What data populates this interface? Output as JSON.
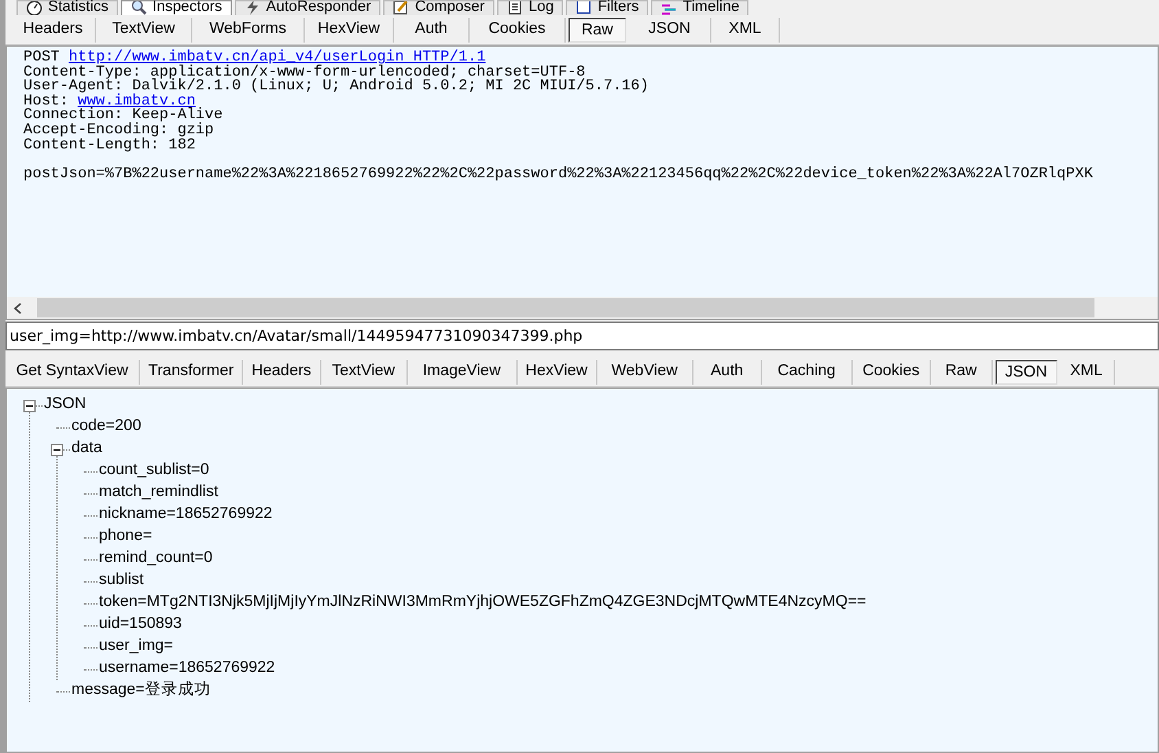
{
  "main_tabs": [
    {
      "label": "Statistics",
      "selected": false
    },
    {
      "label": "Inspectors",
      "selected": true
    },
    {
      "label": "AutoResponder",
      "selected": false
    },
    {
      "label": "Composer",
      "selected": false
    },
    {
      "label": "Log",
      "selected": false
    },
    {
      "label": "Filters",
      "selected": false
    },
    {
      "label": "Timeline",
      "selected": false
    }
  ],
  "request_tabs": [
    {
      "label": "Headers",
      "selected": false
    },
    {
      "label": "TextView",
      "selected": false
    },
    {
      "label": "WebForms",
      "selected": false
    },
    {
      "label": "HexView",
      "selected": false
    },
    {
      "label": "Auth",
      "selected": false
    },
    {
      "label": "Cookies",
      "selected": false
    },
    {
      "label": "Raw",
      "selected": true
    },
    {
      "label": "JSON",
      "selected": false
    },
    {
      "label": "XML",
      "selected": false
    }
  ],
  "raw_request": {
    "headers": [
      [
        {
          "kind": "text",
          "text": "POST "
        },
        {
          "kind": "link",
          "text": "http://www.imbatv.cn/api_v4/userLogin HTTP/1.1"
        }
      ],
      [
        {
          "kind": "text",
          "text": "Content-Type: application/x-www-form-urlencoded; charset=UTF-8"
        }
      ],
      [
        {
          "kind": "text",
          "text": "User-Agent: Dalvik/2.1.0 (Linux; U; Android 5.0.2; MI 2C MIUI/5.7.16)"
        }
      ],
      [
        {
          "kind": "text",
          "text": "Host: "
        },
        {
          "kind": "link",
          "text": "www.imbatv.cn"
        }
      ],
      [
        {
          "kind": "text",
          "text": "Connection: Keep-Alive"
        }
      ],
      [
        {
          "kind": "text",
          "text": "Accept-Encoding: gzip"
        }
      ],
      [
        {
          "kind": "text",
          "text": "Content-Length: 182"
        }
      ]
    ],
    "body": "postJson=%7B%22username%22%3A%2218652769922%22%2C%22password%22%3A%22123456qq%22%2C%22device_token%22%3A%22Al7OZRlqPXK"
  },
  "status_field": {
    "value": "user_img=http://www.imbatv.cn/Avatar/small/14495947731090347399.php"
  },
  "response_tabs": [
    {
      "label": "Get SyntaxView",
      "selected": false
    },
    {
      "label": "Transformer",
      "selected": false
    },
    {
      "label": "Headers",
      "selected": false
    },
    {
      "label": "TextView",
      "selected": false
    },
    {
      "label": "ImageView",
      "selected": false
    },
    {
      "label": "HexView",
      "selected": false
    },
    {
      "label": "WebView",
      "selected": false
    },
    {
      "label": "Auth",
      "selected": false
    },
    {
      "label": "Caching",
      "selected": false
    },
    {
      "label": "Cookies",
      "selected": false
    },
    {
      "label": "Raw",
      "selected": false
    },
    {
      "label": "JSON",
      "selected": true
    },
    {
      "label": "XML",
      "selected": false
    }
  ],
  "json_tree": [
    {
      "label": "JSON",
      "expanded": true,
      "children": [
        {
          "label": "code=200"
        },
        {
          "label": "data",
          "expanded": true,
          "children": [
            {
              "label": "count_sublist=0"
            },
            {
              "label": "match_remindlist"
            },
            {
              "label": "nickname=18652769922"
            },
            {
              "label": "phone="
            },
            {
              "label": "remind_count=0"
            },
            {
              "label": "sublist"
            },
            {
              "label": "token=MTg2NTI3Njk5MjIjMjIyYmJlNzRiNWI3MmRmYjhjOWE5ZGFhZmQ4ZGE3NDcjMTQwMTE4NzcyMQ=="
            },
            {
              "label": "uid=150893"
            },
            {
              "label": "user_img="
            },
            {
              "label": "username=18652769922"
            }
          ]
        },
        {
          "label": "message=登录成功"
        }
      ]
    }
  ]
}
